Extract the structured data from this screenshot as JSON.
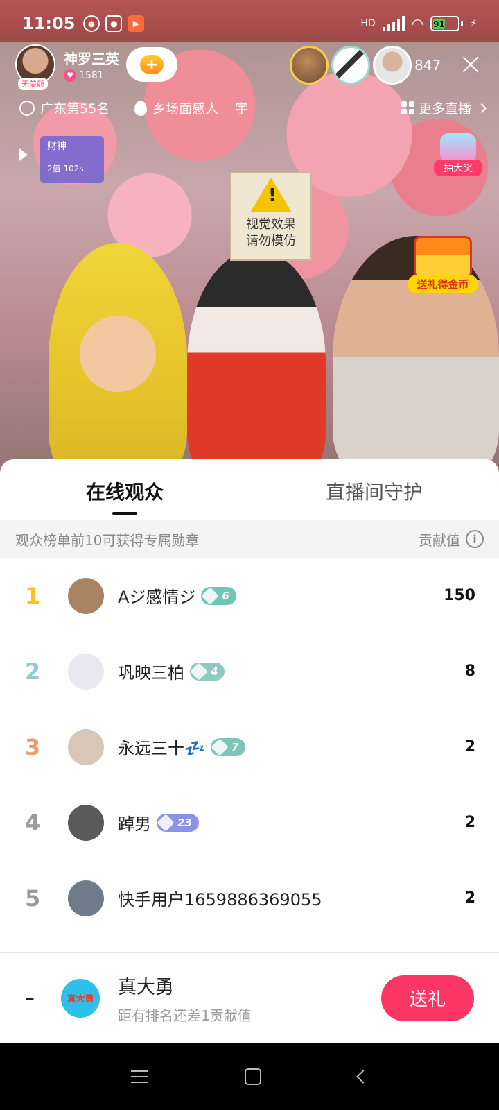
{
  "status_bar": {
    "time": "11:05",
    "network": "HD",
    "battery": "91"
  },
  "streamer": {
    "name": "神罗三英",
    "likes": "1581",
    "avatar_tag": "无美颜"
  },
  "viewers": {
    "count": "847"
  },
  "info_bar": {
    "rank": "广东第55名",
    "topic": "乡场面感人",
    "topic_extra": "宇",
    "more_live": "更多直播"
  },
  "widgets": {
    "caishen_title": "财神",
    "caishen_timer": "2倍 102s",
    "draw_prize": "抽大奖",
    "gift_coin": "送礼得金币"
  },
  "video": {
    "sign_text": [
      "视觉效果",
      "请勿模仿"
    ]
  },
  "sheet": {
    "tabs": [
      {
        "label": "在线观众",
        "active": true
      },
      {
        "label": "直播间守护",
        "active": false
      }
    ],
    "notice": "观众榜单前10可获得专属勋章",
    "contribution_label": "贡献值",
    "rankings": [
      {
        "rank": "1",
        "name": "Aジ感情ジ",
        "level": "6",
        "score": "150",
        "rank_color": "#f5c518",
        "badge_color": "#6cc7b9",
        "avatar_color": "#a98463"
      },
      {
        "rank": "2",
        "name": "巩映三柏",
        "level": "4",
        "score": "8",
        "rank_color": "#8ecdd0",
        "badge_color": "#8fc9c2",
        "avatar_color": "#e8e8ee"
      },
      {
        "rank": "3",
        "name": "永远三十💤",
        "level": "7",
        "score": "2",
        "rank_color": "#ef9a6e",
        "badge_color": "#7fc4bc",
        "avatar_color": "#d8c7b6"
      },
      {
        "rank": "4",
        "name": "踔男",
        "level": "23",
        "score": "2",
        "rank_color": "#9a9a9a",
        "badge_color": "#8b93e6",
        "avatar_color": "#5a5a5a"
      },
      {
        "rank": "5",
        "name": "快手用户1659886369055",
        "level": "",
        "score": "2",
        "rank_color": "#9a9a9a",
        "badge_color": "",
        "avatar_color": "#6f7a8a"
      }
    ],
    "self": {
      "rank": "–",
      "avatar_text": "真大勇",
      "name": "真大勇",
      "subtitle": "距有排名还差1贡献值",
      "gift_button": "送礼"
    }
  },
  "colors": {
    "accent": "#fe3666",
    "gift_chest": "#ffd400"
  }
}
